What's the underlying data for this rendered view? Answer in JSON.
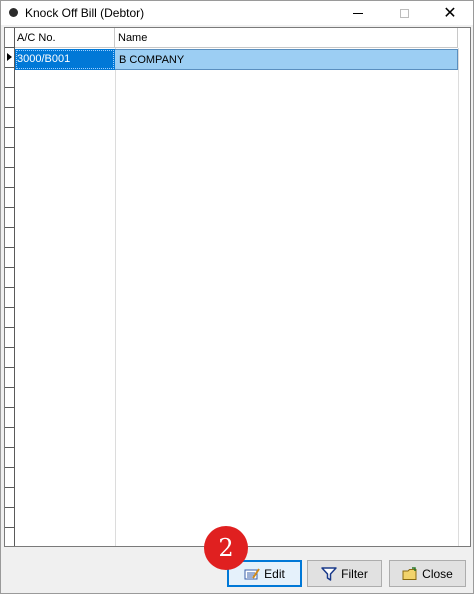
{
  "window": {
    "title": "Knock Off Bill (Debtor)",
    "close_glyph": "✕"
  },
  "grid": {
    "columns": [
      "A/C No.",
      "Name"
    ],
    "rows": [
      {
        "acno": "3000/B001",
        "name": "B COMPANY",
        "selected": true
      }
    ]
  },
  "buttons": {
    "edit": {
      "label": "Edit",
      "icon": "edit-icon"
    },
    "filter": {
      "label": "Filter",
      "icon": "funnel-icon"
    },
    "close": {
      "label": "Close",
      "icon": "folder-close-icon"
    }
  },
  "annotation": {
    "badge": "2"
  },
  "colors": {
    "selection_cell": "#0078d7",
    "selection_row": "#9ccef3",
    "badge": "#e02020"
  }
}
